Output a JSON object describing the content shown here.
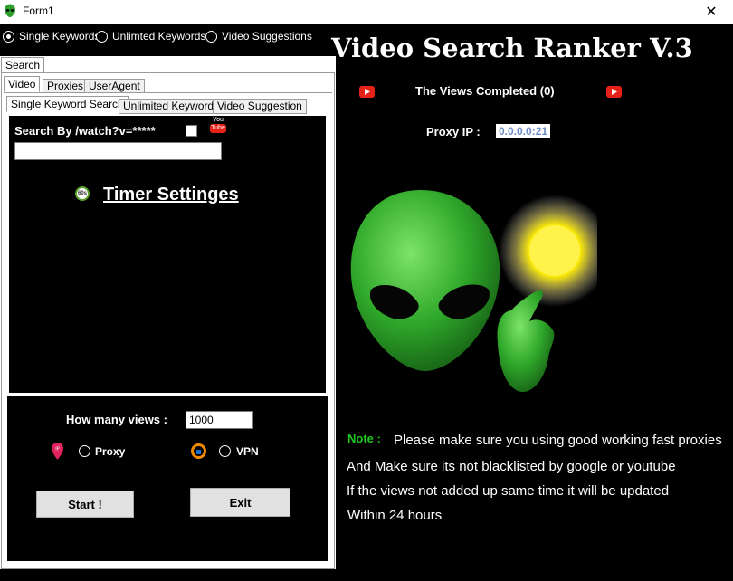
{
  "window": {
    "title": "Form1",
    "close_glyph": "✕"
  },
  "modes": [
    {
      "label": "Single Keywords",
      "checked": true
    },
    {
      "label": "Unlimted Keywords",
      "checked": false
    },
    {
      "label": "Video Suggestions",
      "checked": false
    }
  ],
  "tabs": {
    "top": "Search",
    "second": [
      "Video",
      "Proxies",
      "UserAgent"
    ],
    "third": [
      "Single Keyword Search",
      "Unlimited Keywords",
      "Video Suggestion"
    ]
  },
  "search": {
    "by_label": "Search By /watch?v=*****",
    "input_value": "",
    "youtube_badge_top": "You",
    "youtube_badge_bottom": "Tube"
  },
  "timer": {
    "icon_text": "60s",
    "label": "Timer Settinges"
  },
  "views": {
    "label": "How many views :",
    "value": "1000"
  },
  "connection": {
    "proxy_label": "Proxy",
    "vpn_label": "VPN",
    "ip_badge": "IP"
  },
  "buttons": {
    "start": "Start !",
    "exit": "Exit"
  },
  "header": {
    "title": "Video Search Ranker V.3",
    "views_completed": "The Views Completed (0)",
    "proxy_ip_label": "Proxy IP :",
    "proxy_ip_value": "0.0.0.0:21"
  },
  "notes": {
    "label": "Note :",
    "line1": "Please make sure you using good working fast proxies",
    "line2": "And Make sure its not blacklisted by google or youtube",
    "line3": "If the views not added up same time it will be updated",
    "line4": "Within 24 hours"
  },
  "colors": {
    "note_green": "#1ec81e",
    "youtube_red": "#e62117",
    "proxy_ip_fg": "#6c8cc8"
  }
}
